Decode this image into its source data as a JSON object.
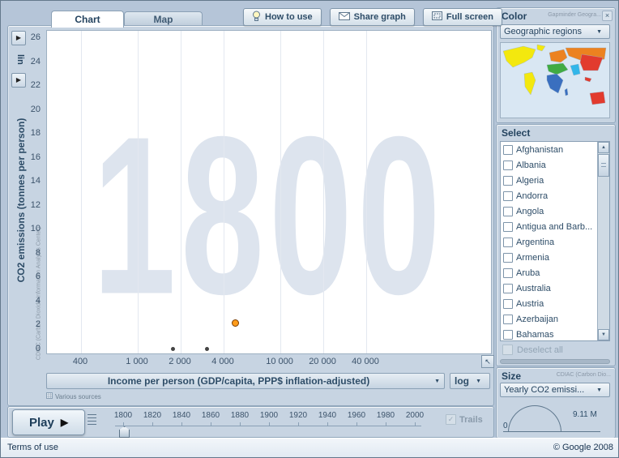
{
  "tabs": [
    {
      "label": "Chart"
    },
    {
      "label": "Map"
    }
  ],
  "toolbar": {
    "buttons": [
      {
        "label": "How to use",
        "icon": "lightbulb-icon"
      },
      {
        "label": "Share graph",
        "icon": "envelope-icon"
      },
      {
        "label": "Full screen",
        "icon": "fullscreen-icon"
      }
    ]
  },
  "color_panel": {
    "title": "Color",
    "source": "Gapminder Geogra...",
    "dropdown_value": "Geographic regions",
    "map_colors": {
      "americas": "#f3e80e",
      "europe_central_asia": "#ec8220",
      "middle_east_north_africa": "#41ab43",
      "sub_saharan_africa": "#3a6fbf",
      "south_asia": "#32b6e9",
      "east_asia_pacific": "#e23b2e"
    }
  },
  "select_panel": {
    "title": "Select",
    "countries": [
      "Afghanistan",
      "Albania",
      "Algeria",
      "Andorra",
      "Angola",
      "Antigua and Barb...",
      "Argentina",
      "Armenia",
      "Aruba",
      "Australia",
      "Austria",
      "Azerbaijan",
      "Bahamas"
    ],
    "deselect_label": "Deselect all"
  },
  "size_panel": {
    "title": "Size",
    "source": "CDIAC (Carbon Dio...",
    "dropdown_value": "Yearly CO2 emissi...",
    "max_label": "9.11 M",
    "min_label": "0"
  },
  "chart": {
    "year_watermark": "1800",
    "y_axis_label": "CO2 emissions (tonnes per person)",
    "x_axis_label": "Income per person (GDP/capita, PPP$ inflation-adjusted)",
    "y_scale_label": "lin",
    "x_scale_label": "log",
    "sources_note": "Various sources",
    "attribution": "CDIAC (Carbon Dioxide Information Analysis Center)"
  },
  "chart_data": {
    "type": "scatter",
    "title": "",
    "xlabel": "Income per person (GDP/capita, PPP$ inflation-adjusted)",
    "ylabel": "CO2 emissions (tonnes per person)",
    "x_scale": "log",
    "year": "1800",
    "x_ticks": [
      400,
      1000,
      2000,
      4000,
      10000,
      20000,
      40000
    ],
    "x_tick_labels": [
      "400",
      "1 000",
      "2 000",
      "4 000",
      "10 000",
      "20 000",
      "40 000"
    ],
    "y_ticks": [
      0,
      2,
      4,
      6,
      8,
      10,
      12,
      14,
      16,
      18,
      20,
      22,
      24,
      26
    ],
    "ylim": [
      0,
      27
    ],
    "points": [
      {
        "x": 4800,
        "y": 2.3,
        "r": 3.5,
        "color": "#ff9c1a",
        "outline": "#7a3c00"
      },
      {
        "x": 1750,
        "y": 0.12,
        "r": 1.5,
        "color": "#444444",
        "outline": "#444444"
      },
      {
        "x": 3000,
        "y": 0.12,
        "r": 1.5,
        "color": "#444444",
        "outline": "#444444"
      }
    ]
  },
  "timeline": {
    "play_label": "Play",
    "years": [
      "1800",
      "1820",
      "1840",
      "1860",
      "1880",
      "1900",
      "1920",
      "1940",
      "1960",
      "1980",
      "2000"
    ],
    "current_year": "1800",
    "trails_label": "Trails"
  },
  "footer": {
    "terms": "Terms of use",
    "copyright": "© Google 2008"
  },
  "icons": {
    "close": "×",
    "dropdown_arrow": "▼",
    "play": "▶",
    "resize": "↖",
    "check": "✓",
    "scroll_up": "▲",
    "scroll_down": "▼",
    "small_arrow": "▶"
  }
}
